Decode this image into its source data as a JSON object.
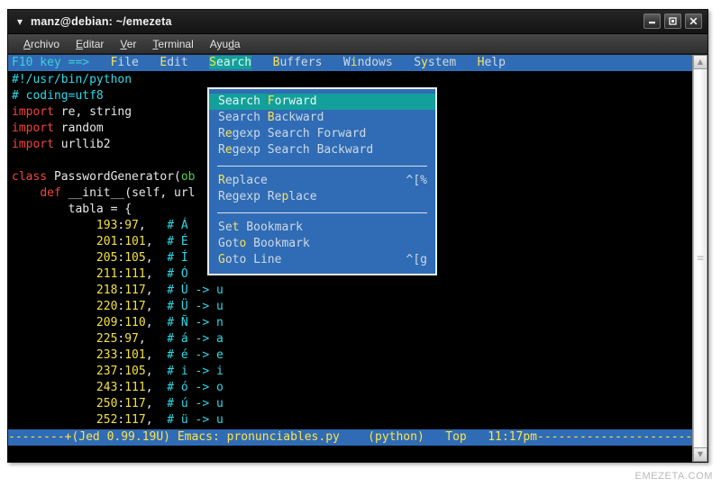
{
  "window": {
    "title": "manz@debian: ~/emezeta",
    "chevron_icon": "chevron-down-icon",
    "buttons": {
      "minimize": "minimize-icon",
      "maximize": "maximize-icon",
      "close": "close-icon"
    }
  },
  "gtk_menubar": {
    "items": [
      {
        "pre": "",
        "mn": "A",
        "post": "rchivo"
      },
      {
        "pre": "",
        "mn": "E",
        "post": "ditar"
      },
      {
        "pre": "",
        "mn": "V",
        "post": "er"
      },
      {
        "pre": "",
        "mn": "T",
        "post": "erminal"
      },
      {
        "pre": "Ayu",
        "mn": "d",
        "post": "a"
      }
    ]
  },
  "emacs_menubar": {
    "hint": "F10 key ==>",
    "items": [
      {
        "pre": "",
        "mn": "F",
        "post": "ile",
        "selected": false,
        "gap": "   "
      },
      {
        "pre": "",
        "mn": "E",
        "post": "dit",
        "selected": false,
        "gap": "   "
      },
      {
        "pre": "",
        "mn": "S",
        "post": "earch",
        "selected": true,
        "gap": "   "
      },
      {
        "pre": "",
        "mn": "B",
        "post": "uffers",
        "selected": false,
        "gap": "   "
      },
      {
        "pre": "W",
        "mn": "i",
        "post": "ndows",
        "selected": false,
        "gap": "   "
      },
      {
        "pre": "S",
        "mn": "y",
        "post": "stem",
        "selected": false,
        "gap": "   "
      },
      {
        "pre": "",
        "mn": "H",
        "post": "elp",
        "selected": false,
        "gap": ""
      }
    ]
  },
  "dropdown": {
    "name": "search-menu",
    "groups": [
      {
        "items": [
          {
            "pre": "Search ",
            "mn": "F",
            "post": "orward",
            "accel": "",
            "active": true
          },
          {
            "pre": "Search ",
            "mn": "B",
            "post": "ackward",
            "accel": "",
            "active": false
          },
          {
            "pre": "R",
            "mn": "e",
            "post": "gexp Search Forward",
            "accel": "",
            "active": false
          },
          {
            "pre": "R",
            "mn": "e",
            "post": "gexp Search Backward",
            "accel": "",
            "active": false
          }
        ]
      },
      {
        "items": [
          {
            "pre": "",
            "mn": "R",
            "post": "eplace",
            "accel": "^[%",
            "active": false
          },
          {
            "pre": "Regexp Re",
            "mn": "p",
            "post": "lace",
            "accel": "",
            "active": false
          }
        ]
      },
      {
        "items": [
          {
            "pre": "Se",
            "mn": "t",
            "post": " Bookmark",
            "accel": "",
            "active": false
          },
          {
            "pre": "Got",
            "mn": "o",
            "post": " Bookmark",
            "accel": "",
            "active": false
          },
          {
            "pre": "",
            "mn": "G",
            "post": "oto Line",
            "accel": "^[g",
            "active": false
          }
        ]
      }
    ]
  },
  "code_lines": [
    [
      {
        "t": "#!/usr/bin/python",
        "c": "c-cmt"
      }
    ],
    [
      {
        "t": "# coding=utf8",
        "c": "c-cmt"
      }
    ],
    [
      {
        "t": "import",
        "c": "c-kw"
      },
      {
        "t": " re, string",
        "c": "c-pl"
      }
    ],
    [
      {
        "t": "import",
        "c": "c-kw"
      },
      {
        "t": " random",
        "c": "c-pl"
      }
    ],
    [
      {
        "t": "import",
        "c": "c-kw"
      },
      {
        "t": " urllib2",
        "c": "c-pl"
      }
    ],
    [
      {
        "t": "",
        "c": "c-pl"
      }
    ],
    [
      {
        "t": "class",
        "c": "c-kw"
      },
      {
        "t": " PasswordGenerator(",
        "c": "c-fn"
      },
      {
        "t": "ob",
        "c": "c-grn"
      }
    ],
    [
      {
        "t": "    ",
        "c": "c-pl"
      },
      {
        "t": "def",
        "c": "c-kw"
      },
      {
        "t": " __init__(self, url",
        "c": "c-fn"
      }
    ],
    [
      {
        "t": "        tabla = {",
        "c": "c-pl"
      }
    ],
    [
      {
        "t": "            ",
        "c": "c-pl"
      },
      {
        "t": "193",
        "c": "c-num"
      },
      {
        "t": ":",
        "c": "c-pl"
      },
      {
        "t": "97",
        "c": "c-num"
      },
      {
        "t": ",",
        "c": "c-pl"
      },
      {
        "t": "   # Á",
        "c": "c-cmt"
      }
    ],
    [
      {
        "t": "            ",
        "c": "c-pl"
      },
      {
        "t": "201",
        "c": "c-num"
      },
      {
        "t": ":",
        "c": "c-pl"
      },
      {
        "t": "101",
        "c": "c-num"
      },
      {
        "t": ",",
        "c": "c-pl"
      },
      {
        "t": "  # É",
        "c": "c-cmt"
      }
    ],
    [
      {
        "t": "            ",
        "c": "c-pl"
      },
      {
        "t": "205",
        "c": "c-num"
      },
      {
        "t": ":",
        "c": "c-pl"
      },
      {
        "t": "105",
        "c": "c-num"
      },
      {
        "t": ",",
        "c": "c-pl"
      },
      {
        "t": "  # Í",
        "c": "c-cmt"
      }
    ],
    [
      {
        "t": "            ",
        "c": "c-pl"
      },
      {
        "t": "211",
        "c": "c-num"
      },
      {
        "t": ":",
        "c": "c-pl"
      },
      {
        "t": "111",
        "c": "c-num"
      },
      {
        "t": ",",
        "c": "c-pl"
      },
      {
        "t": "  # Ó",
        "c": "c-cmt"
      }
    ],
    [
      {
        "t": "            ",
        "c": "c-pl"
      },
      {
        "t": "218",
        "c": "c-num"
      },
      {
        "t": ":",
        "c": "c-pl"
      },
      {
        "t": "117",
        "c": "c-num"
      },
      {
        "t": ",",
        "c": "c-pl"
      },
      {
        "t": "  # Ú -> u",
        "c": "c-cmt"
      }
    ],
    [
      {
        "t": "            ",
        "c": "c-pl"
      },
      {
        "t": "220",
        "c": "c-num"
      },
      {
        "t": ":",
        "c": "c-pl"
      },
      {
        "t": "117",
        "c": "c-num"
      },
      {
        "t": ",",
        "c": "c-pl"
      },
      {
        "t": "  # Ü -> u",
        "c": "c-cmt"
      }
    ],
    [
      {
        "t": "            ",
        "c": "c-pl"
      },
      {
        "t": "209",
        "c": "c-num"
      },
      {
        "t": ":",
        "c": "c-pl"
      },
      {
        "t": "110",
        "c": "c-num"
      },
      {
        "t": ",",
        "c": "c-pl"
      },
      {
        "t": "  # Ñ -> n",
        "c": "c-cmt"
      }
    ],
    [
      {
        "t": "            ",
        "c": "c-pl"
      },
      {
        "t": "225",
        "c": "c-num"
      },
      {
        "t": ":",
        "c": "c-pl"
      },
      {
        "t": "97",
        "c": "c-num"
      },
      {
        "t": ",",
        "c": "c-pl"
      },
      {
        "t": "   # á -> a",
        "c": "c-cmt"
      }
    ],
    [
      {
        "t": "            ",
        "c": "c-pl"
      },
      {
        "t": "233",
        "c": "c-num"
      },
      {
        "t": ":",
        "c": "c-pl"
      },
      {
        "t": "101",
        "c": "c-num"
      },
      {
        "t": ",",
        "c": "c-pl"
      },
      {
        "t": "  # é -> e",
        "c": "c-cmt"
      }
    ],
    [
      {
        "t": "            ",
        "c": "c-pl"
      },
      {
        "t": "237",
        "c": "c-num"
      },
      {
        "t": ":",
        "c": "c-pl"
      },
      {
        "t": "105",
        "c": "c-num"
      },
      {
        "t": ",",
        "c": "c-pl"
      },
      {
        "t": "  # i -> i",
        "c": "c-cmt"
      }
    ],
    [
      {
        "t": "            ",
        "c": "c-pl"
      },
      {
        "t": "243",
        "c": "c-num"
      },
      {
        "t": ":",
        "c": "c-pl"
      },
      {
        "t": "111",
        "c": "c-num"
      },
      {
        "t": ",",
        "c": "c-pl"
      },
      {
        "t": "  # ó -> o",
        "c": "c-cmt"
      }
    ],
    [
      {
        "t": "            ",
        "c": "c-pl"
      },
      {
        "t": "250",
        "c": "c-num"
      },
      {
        "t": ":",
        "c": "c-pl"
      },
      {
        "t": "117",
        "c": "c-num"
      },
      {
        "t": ",",
        "c": "c-pl"
      },
      {
        "t": "  # ú -> u",
        "c": "c-cmt"
      }
    ],
    [
      {
        "t": "            ",
        "c": "c-pl"
      },
      {
        "t": "252",
        "c": "c-num"
      },
      {
        "t": ":",
        "c": "c-pl"
      },
      {
        "t": "117",
        "c": "c-num"
      },
      {
        "t": ",",
        "c": "c-pl"
      },
      {
        "t": "  # ü -> u",
        "c": "c-cmt"
      }
    ]
  ],
  "modeline": {
    "text": "--------+(Jed 0.99.19U) Emacs: pronunciables.py    (python)   Top   11:17pm------------------------",
    "editor": "Jed 0.99.19U",
    "filename": "pronunciables.py",
    "mode": "(python)",
    "position": "Top",
    "time": "11:17pm"
  },
  "scrollbar": {
    "up_icon": "triangle-up-icon",
    "down_icon": "triangle-down-icon",
    "grip_icon": "grip-lines-icon"
  },
  "watermark": "EMEZETA.COM",
  "colors": {
    "terminal_bg": "#000000",
    "menu_blue": "#2f6cb5",
    "highlight_teal": "#14a09a",
    "accent_yellow": "#ffe14d",
    "comment_cyan": "#2fd9e8",
    "keyword_red": "#f0453c"
  }
}
